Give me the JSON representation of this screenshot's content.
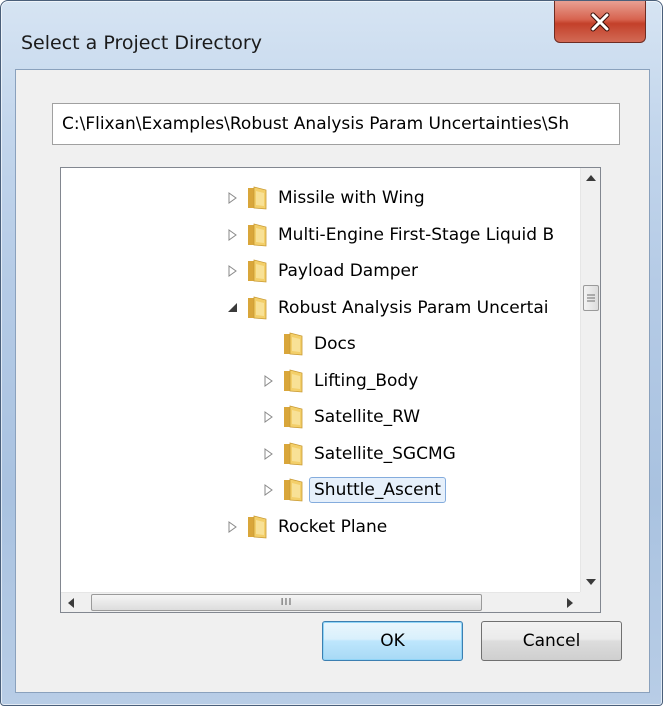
{
  "window": {
    "title": "Select a Project Directory",
    "close_icon": "close-icon"
  },
  "path": {
    "value": "C:\\Flixan\\Examples\\Robust Analysis Param Uncertainties\\Sh"
  },
  "tree": {
    "rows": [
      {
        "label": "Missile with Wing",
        "expander": "collapsed",
        "level": 0
      },
      {
        "label": "Multi-Engine First-Stage Liquid B",
        "expander": "collapsed",
        "level": 0
      },
      {
        "label": "Payload Damper",
        "expander": "collapsed",
        "level": 0
      },
      {
        "label": "Robust Analysis Param Uncertai",
        "expander": "expanded",
        "level": 0
      },
      {
        "label": "Docs",
        "expander": "none",
        "level": 1
      },
      {
        "label": "Lifting_Body",
        "expander": "collapsed",
        "level": 1
      },
      {
        "label": "Satellite_RW",
        "expander": "collapsed",
        "level": 1
      },
      {
        "label": "Satellite_SGCMG",
        "expander": "collapsed",
        "level": 1
      },
      {
        "label": "Shuttle_Ascent",
        "expander": "collapsed",
        "level": 1,
        "selected": true
      },
      {
        "label": "Rocket Plane",
        "expander": "collapsed",
        "level": 0
      }
    ],
    "hscroll_grip": "III"
  },
  "buttons": {
    "ok_label": "OK",
    "cancel_label": "Cancel"
  },
  "colors": {
    "frame": "#b5cbe6",
    "close": "#c3402a",
    "selection_bg": "#e6f0fb",
    "selection_border": "#84acdd",
    "folder": "#e8b64a"
  }
}
